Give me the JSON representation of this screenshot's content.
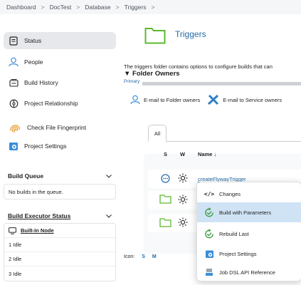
{
  "breadcrumb": [
    "Dashboard",
    "DocTest",
    "Database",
    "Triggers"
  ],
  "sidebar": {
    "tasks": [
      {
        "label": "Status"
      },
      {
        "label": "People"
      },
      {
        "label": "Build History"
      },
      {
        "label": "Project Relationship"
      },
      {
        "label": "Check File Fingerprint"
      },
      {
        "label": "Project Settings"
      }
    ],
    "build_queue": {
      "title": "Build Queue",
      "empty": "No builds in the queue."
    },
    "executor": {
      "title": "Build Executor Status",
      "node": "Built-In Node",
      "rows": [
        "1  Idle",
        "2  Idle",
        "3  Idle"
      ]
    }
  },
  "main": {
    "title": "Triggers",
    "description": "The triggers folder contains options to configure builds that can",
    "owners_heading": "Folder Owners",
    "primary_label": "Primary",
    "email_folder": "E-mail to Folder owners",
    "email_service": "E-mail to Service owners",
    "tab_all": "All",
    "columns": {
      "s": "S",
      "w": "W",
      "name": "Name ↓"
    },
    "jobs": [
      {
        "name": "createFlywayTrigger",
        "kind": "pipeline"
      },
      {
        "name": "",
        "kind": "folder"
      },
      {
        "name": "",
        "kind": "folder"
      }
    ],
    "icon_label": "Icon:",
    "icon_sizes": [
      "S",
      "M"
    ]
  },
  "menu": {
    "items": [
      {
        "label": "Changes",
        "icon": "code-icon"
      },
      {
        "label": "Build with Parameters",
        "icon": "build-run-icon"
      },
      {
        "label": "Rebuild Last",
        "icon": "rebuild-icon"
      },
      {
        "label": "Project Settings",
        "icon": "settings-icon"
      },
      {
        "label": "Job DSL API Reference",
        "icon": "document-icon"
      }
    ],
    "highlighted": "Build with Parameters"
  },
  "colors": {
    "link": "#246ca8",
    "folder_green": "#5cb82e",
    "highlight": "#cfe3f5"
  }
}
